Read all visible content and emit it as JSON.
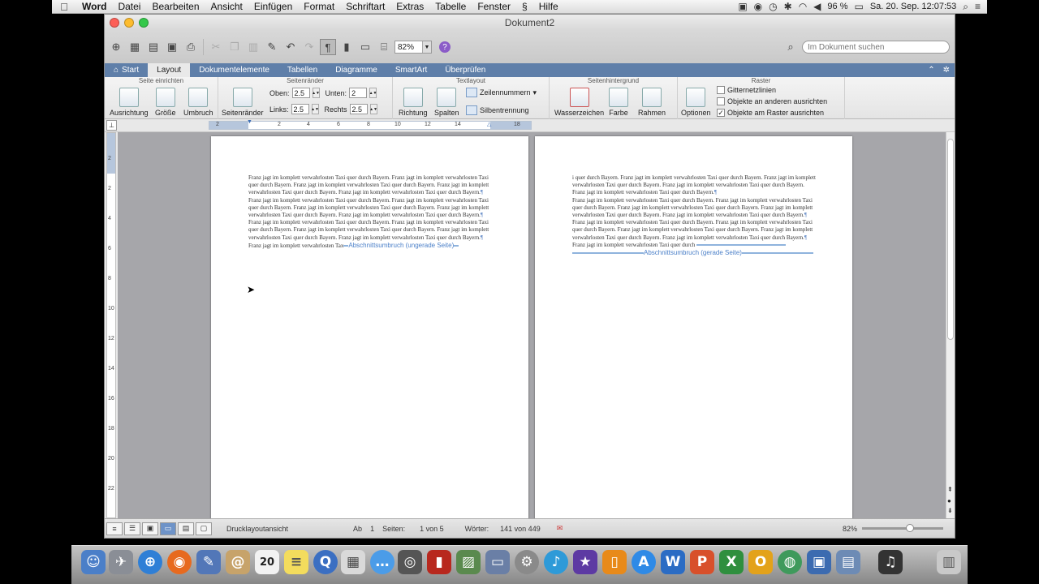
{
  "menubar": {
    "app": "Word",
    "items": [
      "Datei",
      "Bearbeiten",
      "Ansicht",
      "Einfügen",
      "Format",
      "Schriftart",
      "Extras",
      "Tabelle",
      "Fenster",
      "Hilfe"
    ],
    "battery": "96 %",
    "clock": "Sa. 20. Sep.  12:07:53"
  },
  "window": {
    "title": "Dokument2"
  },
  "toolbar": {
    "zoom": "82%",
    "search_placeholder": "Im Dokument suchen"
  },
  "tabs": [
    "Start",
    "Layout",
    "Dokumentelemente",
    "Tabellen",
    "Diagramme",
    "SmartArt",
    "Überprüfen"
  ],
  "active_tab": "Layout",
  "ribbon": {
    "page_setup": {
      "title": "Seite einrichten",
      "buttons": [
        "Ausrichtung",
        "Größe",
        "Umbruch"
      ]
    },
    "margins": {
      "title": "Seitenränder",
      "button": "Seitenränder",
      "top_label": "Oben:",
      "top_value": "2.5",
      "bottom_label": "Unten:",
      "bottom_value": "2",
      "left_label": "Links:",
      "left_value": "2.5",
      "right_label": "Rechts",
      "right_value": "2.5"
    },
    "text_layout": {
      "title": "Textlayout",
      "buttons": [
        "Richtung",
        "Spalten"
      ],
      "line_numbers": "Zeilennummern",
      "hyphenation": "Silbentrennung"
    },
    "background": {
      "title": "Seitenhintergrund",
      "buttons": [
        "Wasserzeichen",
        "Farbe",
        "Rahmen"
      ]
    },
    "grid": {
      "title": "Raster",
      "button": "Optionen",
      "options": [
        {
          "label": "Gitternetzlinien",
          "checked": false
        },
        {
          "label": "Objekte an anderen ausrichten",
          "checked": false
        },
        {
          "label": "Objekte am Raster ausrichten",
          "checked": true
        }
      ]
    }
  },
  "ruler": {
    "labels": [
      "2",
      "2",
      "4",
      "6",
      "8",
      "10",
      "12",
      "14",
      "18"
    ]
  },
  "vruler": {
    "labels": [
      "2",
      "2",
      "4",
      "6",
      "8",
      "10",
      "12",
      "14",
      "16",
      "18",
      "20",
      "22"
    ]
  },
  "page1": {
    "paragraphs": [
      "Franz jagt im komplett verwahrlosten Taxi quer durch Bayern. Franz jagt im komplett verwahrlosten Taxi quer durch Bayern. Franz jagt im komplett verwahrlosten Taxi quer durch Bayern. Franz jagt im komplett verwahrlosten Taxi quer durch Bayern. Franz jagt im komplett verwahrlosten Taxi quer durch Bayern.",
      "Franz jagt im komplett verwahrlosten Taxi quer durch Bayern. Franz jagt im komplett verwahrlosten Taxi quer durch Bayern. Franz jagt im komplett verwahrlosten Taxi quer durch Bayern. Franz jagt im komplett verwahrlosten Taxi quer durch Bayern. Franz jagt im komplett verwahrlosten Taxi quer durch Bayern.",
      "Franz jagt im komplett verwahrlosten Taxi quer durch Bayern. Franz jagt im komplett verwahrlosten Taxi quer durch Bayern. Franz jagt im komplett verwahrlosten Taxi quer durch Bayern. Franz jagt im komplett verwahrlosten Taxi quer durch Bayern. Franz jagt im komplett verwahrlosten Taxi quer durch Bayern."
    ],
    "last_line": "Franz jagt im komplett verwahrlosten Tax",
    "break_label": "Abschnittsumbruch (ungerade Seite)"
  },
  "page2": {
    "paragraphs": [
      "i quer durch Bayern. Franz jagt im komplett verwahrlosten Taxi quer durch Bayern. Franz jagt im komplett verwahrlosten Taxi quer durch Bayern. Franz jagt im komplett verwahrlosten Taxi quer durch Bayern. Franz jagt im komplett verwahrlosten Taxi quer durch Bayern.",
      "Franz jagt im komplett verwahrlosten Taxi quer durch Bayern. Franz jagt im komplett verwahrlosten Taxi quer durch Bayern. Franz jagt im komplett verwahrlosten Taxi quer durch Bayern. Franz jagt im komplett verwahrlosten Taxi quer durch Bayern. Franz jagt im komplett verwahrlosten Taxi quer durch Bayern.",
      "Franz jagt im komplett verwahrlosten Taxi quer durch Bayern. Franz jagt im komplett verwahrlosten Taxi quer durch Bayern. Franz jagt im komplett verwahrlosten Taxi quer durch Bayern. Franz jagt im komplett verwahrlosten Taxi quer durch Bayern. Franz jagt im komplett verwahrlosten Taxi quer durch Bayern."
    ],
    "last_line": "Franz jagt im komplett verwahrlosten Taxi quer durch",
    "break_label": "Abschnittsumbruch (gerade Seite)"
  },
  "status": {
    "view": "Drucklayoutansicht",
    "ab_label": "Ab",
    "ab_value": "1",
    "pages_label": "Seiten:",
    "pages_value": "1 von 5",
    "words_label": "Wörter:",
    "words_value": "141 von 449",
    "zoom": "82%"
  },
  "colors": {
    "tabbar": "#5f7fa9",
    "accent": "#4a7fc8"
  }
}
